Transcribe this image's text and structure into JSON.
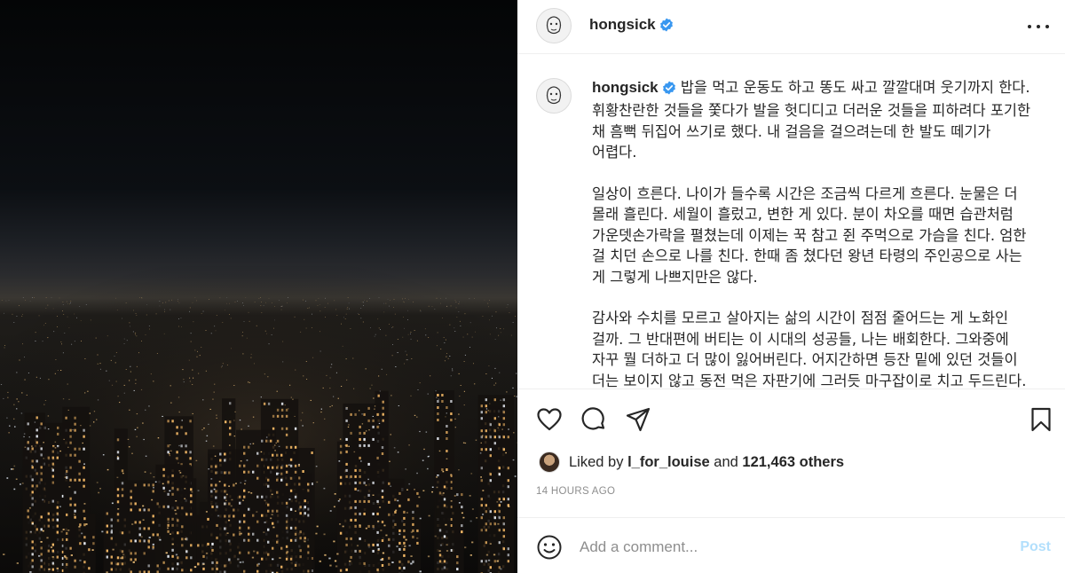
{
  "post": {
    "username": "hongsick",
    "verified": true,
    "caption": "밥을 먹고 운동도 하고 똥도 싸고 깔깔대며 웃기까지 한다. 휘황찬란한 것들을 쫓다가 발을 헛디디고 더러운 것들을 피하려다 포기한 채 흠뻑 뒤집어 쓰기로 했다. 내 걸음을 걸으려는데 한 발도 떼기가 어렵다.\n\n일상이 흐른다. 나이가 들수록 시간은 조금씩 다르게 흐른다. 눈물은 더 몰래 흘린다. 세월이 흘렀고, 변한 게 있다. 분이 차오를 때면 습관처럼 가운뎃손가락을 펼쳤는데 이제는 꾹 참고 쥔 주먹으로 가슴을 친다. 엄한 걸 치던 손으로 나를 친다. 한때 좀 쳤다던 왕년 타령의 주인공으로 사는 게 그렇게 나쁘지만은 않다.\n\n감사와 수치를 모르고 살아지는 삶의 시간이 점점 줄어드는 게 노화인 걸까. 그 반대편에 버티는 이 시대의 성공들, 나는 배회한다. 그와중에 자꾸 뭘 더하고 더 많이 잃어버린다. 어지간하면 등잔 밑에 있던 것들이 더는 보이지 않고 동전 먹은 자판기에 그러듯 마구잡이로 치고 두드린다.",
    "liked_by_prefix": "Liked by",
    "liked_by_user": "l_for_louise",
    "liked_by_and": "and",
    "others_count": "121,463 others",
    "timestamp": "14 HOURS AGO"
  },
  "icons": {
    "more": "more-options-icon",
    "verified": "verified-badge-icon",
    "like": "heart-icon",
    "comment": "comment-bubble-icon",
    "share": "paper-plane-icon",
    "save": "bookmark-icon",
    "emoji": "smiley-icon"
  },
  "comment": {
    "placeholder": "Add a comment...",
    "post_label": "Post"
  },
  "colors": {
    "verified_blue": "#3897f0",
    "post_disabled": "#b2dffc",
    "muted": "#8e8e8e"
  }
}
